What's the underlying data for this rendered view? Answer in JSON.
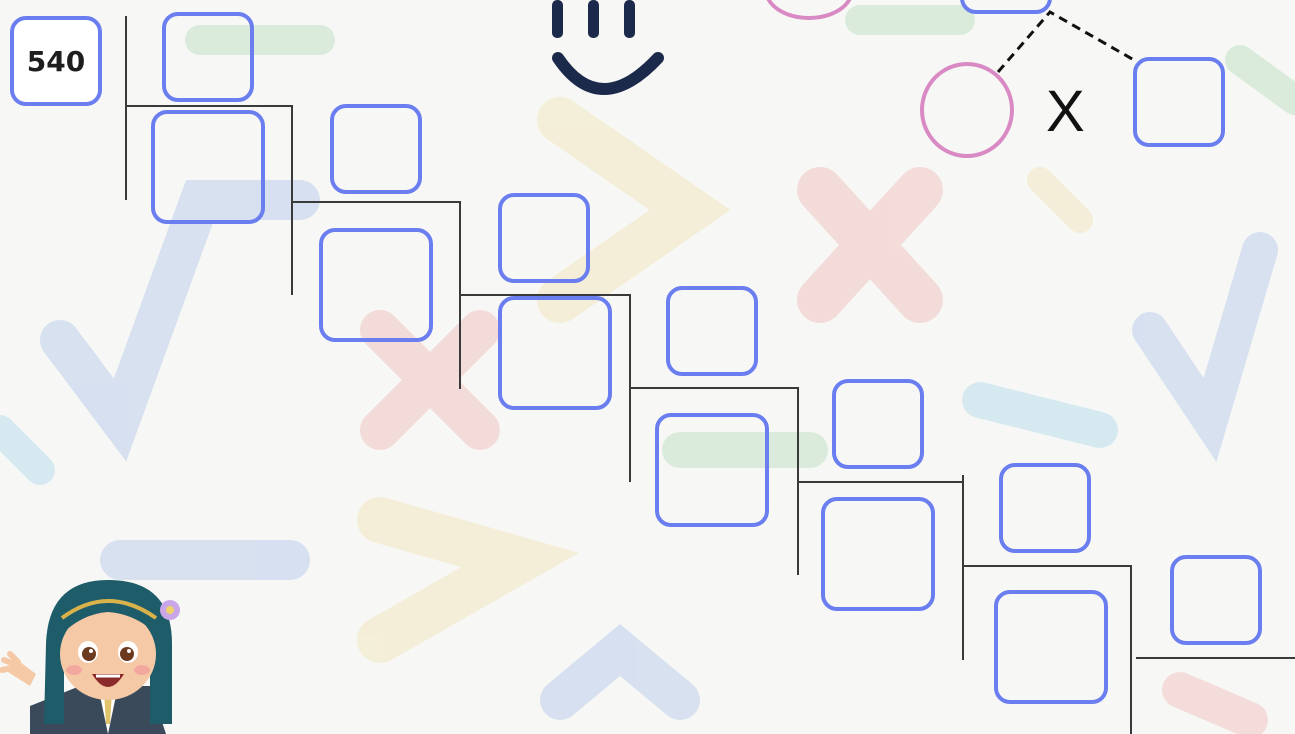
{
  "worksheet": {
    "start_number": "540",
    "times_symbol": "X"
  },
  "logo": {
    "icon": "smile-logo-icon"
  },
  "mascot": {
    "icon": "waving-girl-mascot"
  },
  "colors": {
    "box_border": "#6a7ef0",
    "circle_border": "#d98ac4",
    "line": "#3a3a3a",
    "logo": "#1b2a4a"
  }
}
